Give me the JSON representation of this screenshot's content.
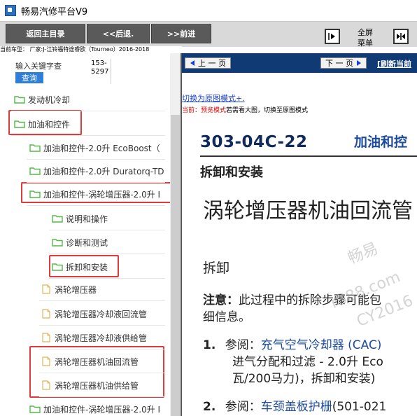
{
  "window": {
    "title": "畅易汽修平台V9"
  },
  "toolbar": {
    "back_main": "返回主目录",
    "prev": "<<后退.",
    "next": ">>前进",
    "fullscreen": "全屏",
    "menu": "菜单"
  },
  "car_info": "当前车型： 厂家:J-江铃福特途睿欧（Tourneo）2016-2018",
  "search": {
    "label": "输入关键字查",
    "button": "查询",
    "num1": "153-",
    "num2": "5297"
  },
  "tree": [
    {
      "label": "发动机冷却",
      "kind": "folder"
    },
    {
      "label": "加油和控件",
      "kind": "folder"
    },
    {
      "label": "加油和控件-2.0升 EcoBoost（",
      "kind": "folder"
    },
    {
      "label": "加油和控件-2.0升 Duratorq-TD",
      "kind": "folder"
    },
    {
      "label": "加油和控件-涡轮增压器-2.0升 I",
      "kind": "folder"
    },
    {
      "label": "说明和操作",
      "kind": "folder"
    },
    {
      "label": "诊断和测试",
      "kind": "folder"
    },
    {
      "label": "拆卸和安装",
      "kind": "folder"
    },
    {
      "label": "涡轮增压器",
      "kind": "doc"
    },
    {
      "label": "涡轮增压器冷却液回流管",
      "kind": "doc"
    },
    {
      "label": "涡轮增压器冷却液供给管",
      "kind": "doc"
    },
    {
      "label": "涡轮增压器机油回流管",
      "kind": "doc"
    },
    {
      "label": "涡轮增压器机油供给管",
      "kind": "doc"
    },
    {
      "label": "加油和控件-涡轮增压器-2.0升 I",
      "kind": "folder"
    }
  ],
  "doc_nav": {
    "prev_page": "上 一 页",
    "next_page": "下 一 页",
    "refresh": "[刷新当前"
  },
  "document": {
    "switch_link": "切换为原图模式+.",
    "mode_prefix": "当前：",
    "mode_name": "预览模式",
    "mode_hint": "若需看大图，切换至原图模式",
    "code": "303-04C-22",
    "heading": "加油和控",
    "section": "拆卸和安装",
    "title": "涡轮增压器机油回流管",
    "subsection": "拆卸",
    "note_label": "注意：",
    "note_text": "此过程中的拆除步骤可能包",
    "note_text2": "细信息。",
    "step1_num": "1.",
    "step1_ref": "参阅：",
    "step1_link": "充气空气冷却器 (CAC)",
    "step1_line2": "进气分配和过滤 - 2.0升 Eco",
    "step1_line3": "瓦/200马力)，拆卸和安装)",
    "step2_num": "2.",
    "step2_ref": "参阅：",
    "step2_link": "车颈盖板护栅",
    "step2_rest": "(501-021"
  },
  "watermark": {
    "line1": "畅易",
    "line2": "r388.com",
    "line3": "CY2016"
  },
  "colors": {
    "highlight": "#e03a3a",
    "nav_bar": "#103a74",
    "query_button": "#2f7fd8",
    "folder": "#54b848"
  }
}
